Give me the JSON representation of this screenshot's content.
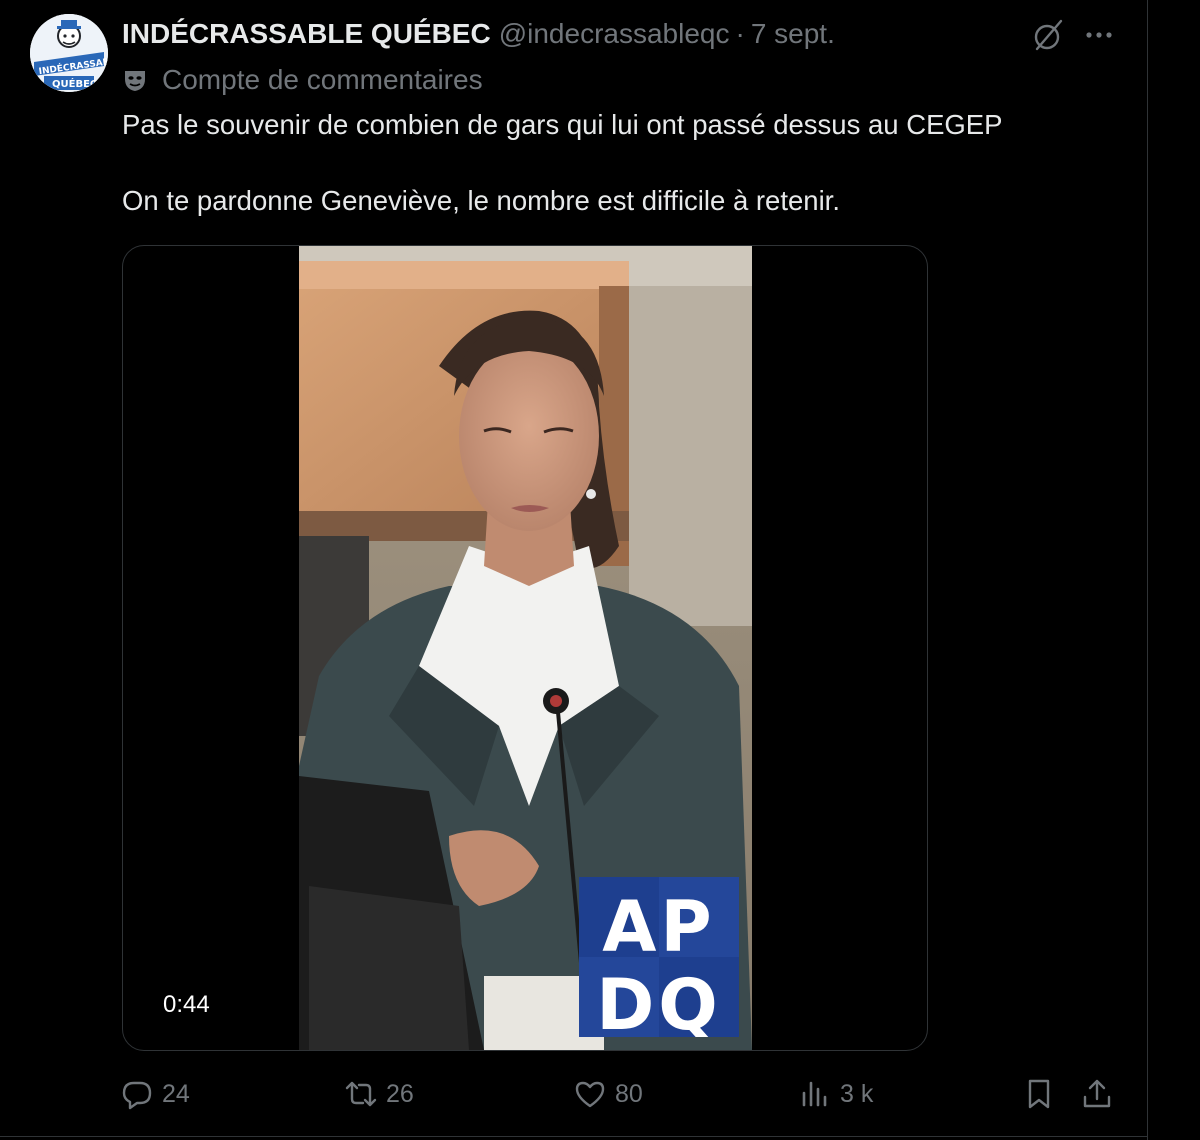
{
  "tweet": {
    "author_name": "INDÉCRASSABLE QUÉBEC",
    "handle": "@indecrassableqc",
    "separator": "·",
    "date": "7 sept.",
    "community_label": "Compte de commentaires",
    "text_line1": "Pas le souvenir de combien de gars qui lui ont passé dessus au CEGEP",
    "text_line2": "On te pardonne Geneviève, le nombre est difficile à retenir."
  },
  "avatar": {
    "logo_line1": "INDÉCRASSABLE",
    "logo_line2": "QUÉBEC"
  },
  "video": {
    "duration": "0:44",
    "logo_top": "AP",
    "logo_bottom": "DQ"
  },
  "actions": {
    "replies": "24",
    "reposts": "26",
    "likes": "80",
    "views": "3 k"
  },
  "colors": {
    "background": "#000000",
    "text_primary": "#e7e9ea",
    "text_secondary": "#71767b",
    "border": "#2f3336",
    "logo_blue": "#1e3f8f"
  },
  "icons": {
    "grok": "grok-icon",
    "more": "more-icon",
    "community": "mask-icon",
    "reply": "reply-icon",
    "repost": "repost-icon",
    "like": "heart-icon",
    "views": "views-icon",
    "bookmark": "bookmark-icon",
    "share": "share-icon"
  }
}
